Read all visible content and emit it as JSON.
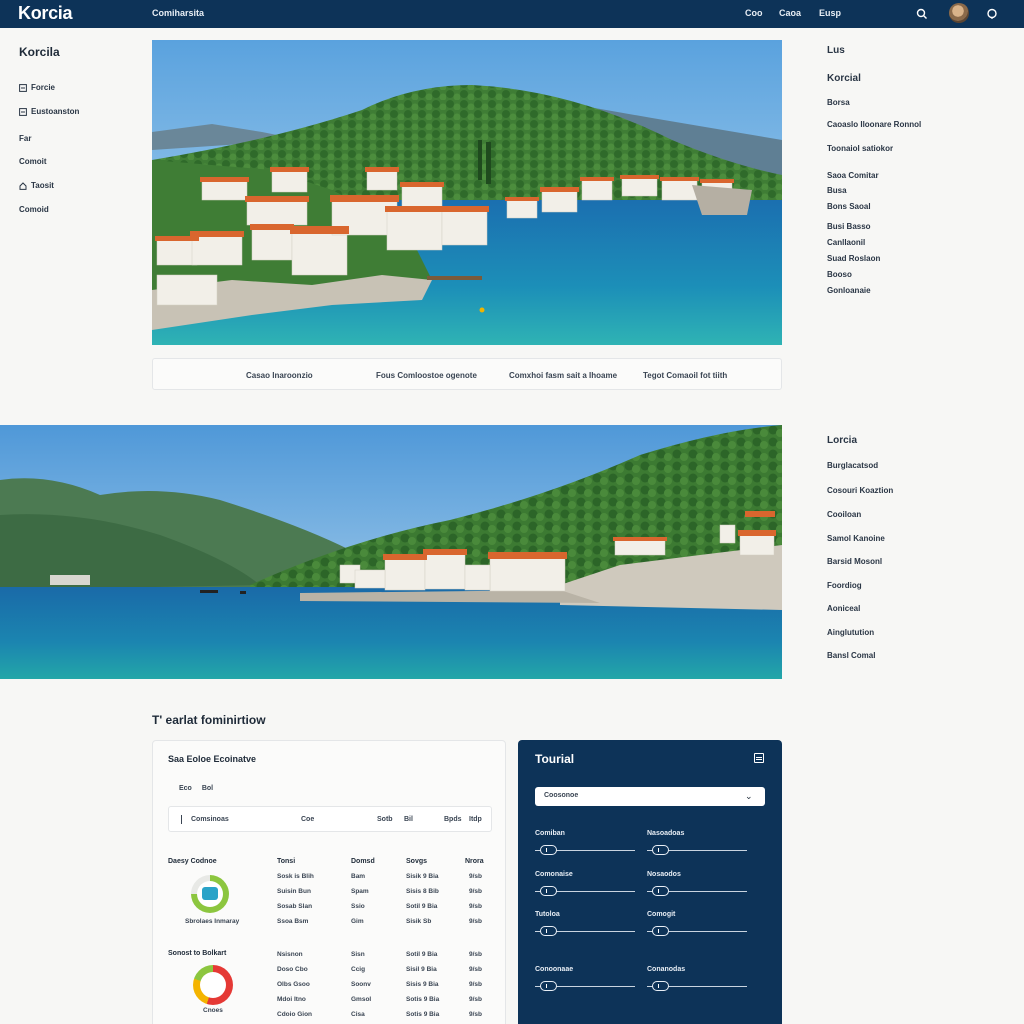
{
  "header": {
    "brand": "Korcia",
    "nav_label": "Comiharsita",
    "links": [
      "Coo",
      "Caoa",
      "Eusp"
    ]
  },
  "sidebar": {
    "title": "Korcila",
    "items": [
      {
        "label": "Forcie",
        "icon": "square-icon"
      },
      {
        "label": "Eustoanston",
        "icon": "square-icon"
      },
      {
        "label": "Far",
        "icon": ""
      },
      {
        "label": "Comoit",
        "icon": ""
      },
      {
        "label": "Taosit",
        "icon": "home-icon"
      },
      {
        "label": "Comoid",
        "icon": ""
      }
    ]
  },
  "captions": [
    "Casao Inaroonzio",
    "Fous Comloostoe ogenote",
    "Comxhoi fasm sait a Ihoame",
    "Tegot Comaoil fot tiith"
  ],
  "right_top": {
    "heading": "Lus",
    "subheading": "Korcial",
    "items": [
      "Borsa",
      "Caoaslo Iloonare Ronnol",
      "Toonaiol satiokor",
      "Saoa Comitar",
      "Busa",
      "Bons Saoal",
      "Busi Basso",
      "Canllaonil",
      "Suad Roslaon",
      "Booso",
      "Gonloanaie"
    ]
  },
  "right_bottom": {
    "heading": "Lorcia",
    "items": [
      "Burglacatsod",
      "Cosouri Koaztion",
      "Cooiloan",
      "Samol Kanoine",
      "Barsid Mosonl",
      "Foordiog",
      "Aoniceal",
      "Ainglutution",
      "Bansl Comal"
    ]
  },
  "section": {
    "title": "T' earlat fominirtiow"
  },
  "card": {
    "title": "Saa Eoloe Ecoinatve",
    "mini_tabs": [
      "Eco",
      "Bol"
    ],
    "filters": [
      "Comsinoas",
      "Coe",
      "Sotb",
      "Bil",
      "Bpds",
      "Itdp"
    ],
    "group1": {
      "label": "Daesy Codnoe",
      "caption": "Sbrolaes Inmaray"
    },
    "group2": {
      "label": "Sonost to Bolkart",
      "caption": "Cnoes"
    },
    "columns": [
      "Tonsi",
      "Domsd",
      "Sovgs",
      "Nrora"
    ],
    "rows": [
      [
        "Sosk is Blih",
        "Bam",
        "Sisik 9 Bia",
        "9/sb"
      ],
      [
        "Suisin Bun",
        "Spam",
        "Sisis 8 Bib",
        "9/sb"
      ],
      [
        "Sosab Slan",
        "Ssio",
        "Sotil 9 Bia",
        "9/sb"
      ],
      [
        "Ssoa Bsm",
        "Gim",
        "Sisik Sb",
        "9/sb"
      ],
      [
        "Nsisnon",
        "Sisn",
        "Sotil 9 Bia",
        "9/sb"
      ],
      [
        "Doso Cbo",
        "Ccig",
        "Sisil 9 Bia",
        "9/sb"
      ],
      [
        "Olbs Gsoo",
        "Soonv",
        "Sisis 9 Bia",
        "9/sb"
      ],
      [
        "Mdoi Itno",
        "Gmsol",
        "Sotis 9 Bia",
        "9/sb"
      ],
      [
        "Cdoio Gion",
        "Cisa",
        "Sotis 9 Bia",
        "9/sb"
      ]
    ]
  },
  "panel": {
    "title": "Tourial",
    "select_value": "Coosonoe",
    "sliders": [
      {
        "label": "Comiban",
        "value": 0.05
      },
      {
        "label": "Nasoadoas",
        "value": 0.05
      },
      {
        "label": "Comonaise",
        "value": 0.05
      },
      {
        "label": "Nosaodos",
        "value": 0.05
      },
      {
        "label": "Tutoloa",
        "value": 0.05
      },
      {
        "label": "Comogit",
        "value": 0.05
      },
      {
        "label": "Conoonaae",
        "value": 0.05
      },
      {
        "label": "Conanodas",
        "value": 0.05
      }
    ]
  },
  "colors": {
    "navy": "#0d3358",
    "sea": "#1e86b3",
    "roof": "#d9662e",
    "ring1": "#8cc63f",
    "ring2": "#e53935"
  }
}
